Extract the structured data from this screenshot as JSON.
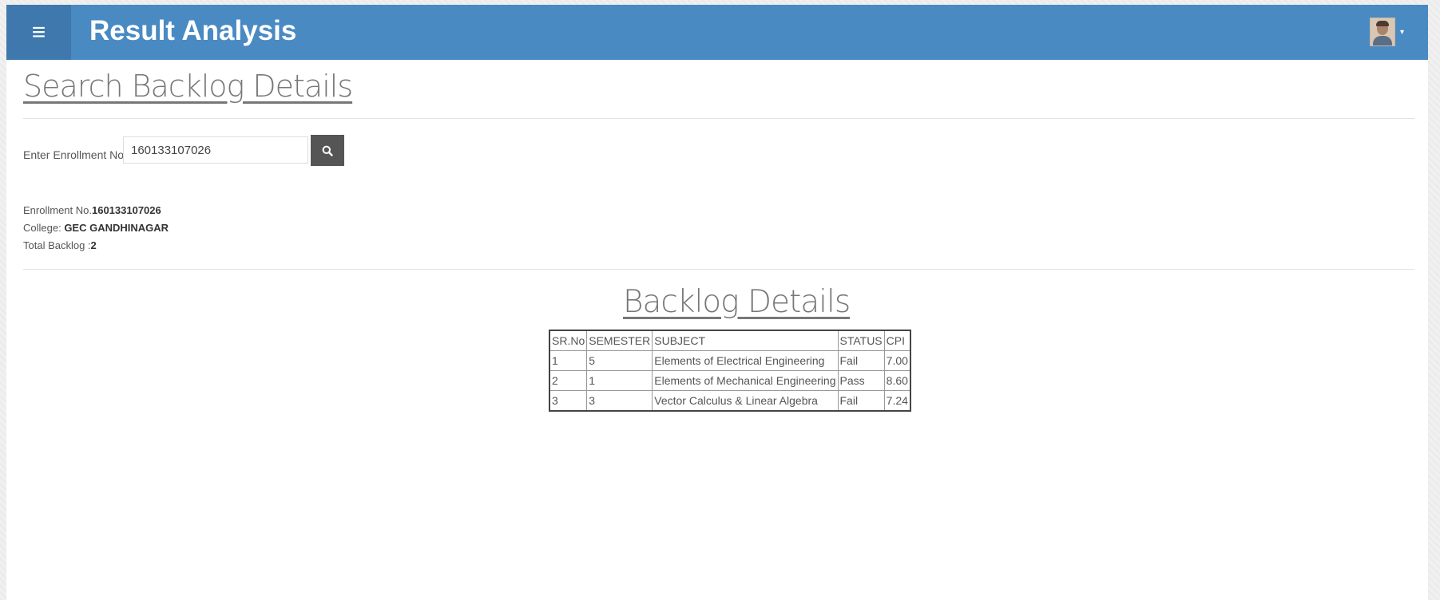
{
  "header": {
    "menu_icon": "≡",
    "title": "Result Analysis",
    "user_caret": "▾"
  },
  "page": {
    "heading": "Search Backlog Details"
  },
  "search": {
    "label": "Enter Enrollment No.",
    "value": "160133107026",
    "button_icon": "search-icon"
  },
  "info": {
    "enrollment_label": "Enrollment No.",
    "enrollment_value": "160133107026",
    "college_label": "College: ",
    "college_value": "GEC GANDHINAGAR",
    "backlog_label": "Total Backlog :",
    "backlog_value": "2"
  },
  "backlog": {
    "heading": "Backlog Details",
    "columns": [
      "SR.No",
      "SEMESTER",
      "SUBJECT",
      "STATUS",
      "CPI"
    ],
    "rows": [
      [
        "1",
        "5",
        "Elements of Electrical Engineering",
        "Fail",
        "7.00"
      ],
      [
        "2",
        "1",
        "Elements of Mechanical Engineering",
        "Pass",
        "8.60"
      ],
      [
        "3",
        "3",
        "Vector Calculus & Linear Algebra",
        "Fail",
        "7.24"
      ]
    ]
  },
  "colors": {
    "header_bg": "#4a8ac3",
    "menu_bg": "#3f78ad",
    "search_button_bg": "#555555"
  }
}
